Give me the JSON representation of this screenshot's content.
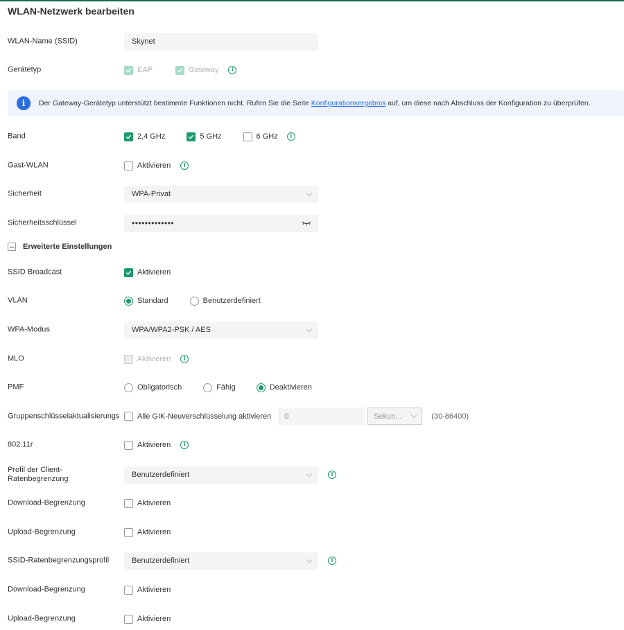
{
  "title": "WLAN-Netzwerk bearbeiten",
  "ssid": {
    "label": "WLAN-Name (SSID)",
    "value": "Skynet"
  },
  "device_type": {
    "label": "Gerätetyp",
    "options": [
      {
        "label": "EAP",
        "checked": true,
        "disabled": true
      },
      {
        "label": "Gateway",
        "checked": true,
        "disabled": true
      }
    ]
  },
  "banner": {
    "text_before": "Der Gateway-Gerätetyp unterstützt bestimmte Funktionen nicht. Rufen Sie die Seite ",
    "link": "Konfigurationsergebnis",
    "text_after": " auf, um diese nach Abschluss der Konfiguration zu überprüfen."
  },
  "band": {
    "label": "Band",
    "options": [
      {
        "label": "2,4 GHz",
        "checked": true
      },
      {
        "label": "5 GHz",
        "checked": true
      },
      {
        "label": "6 GHz",
        "checked": false
      }
    ]
  },
  "guest": {
    "label": "Gast-WLAN",
    "option": "Aktivieren",
    "checked": false
  },
  "security": {
    "label": "Sicherheit",
    "value": "WPA-Privat"
  },
  "key": {
    "label": "Sicherheitsschlüssel",
    "value": "•••••••••••••"
  },
  "advanced": {
    "label": "Erweiterte Einstellungen"
  },
  "ssid_broadcast": {
    "label": "SSID Broadcast",
    "option": "Aktivieren",
    "checked": true
  },
  "vlan": {
    "label": "VLAN",
    "options": [
      {
        "label": "Standard",
        "selected": true
      },
      {
        "label": "Benutzerdefiniert",
        "selected": false
      }
    ]
  },
  "wpa_mode": {
    "label": "WPA-Modus",
    "value": "WPA/WPA2-PSK / AES"
  },
  "mlo": {
    "label": "MLO",
    "option": "Aktivieren",
    "checked": false,
    "disabled": true
  },
  "pmf": {
    "label": "PMF",
    "options": [
      {
        "label": "Obligatorisch",
        "selected": false
      },
      {
        "label": "Fähig",
        "selected": false
      },
      {
        "label": "Deaktivieren",
        "selected": true
      }
    ]
  },
  "gik": {
    "label": "Gruppenschlüsselaktualisierungs",
    "option": "Alle GIK-Neuverschlüsselung aktivieren",
    "checked": false,
    "value": "0",
    "unit": "Sekun...",
    "range": "(30-86400)"
  },
  "r80211": {
    "label": "802.11r",
    "option": "Aktivieren",
    "checked": false
  },
  "client_profile": {
    "label": "Profil der Client-Ratenbegrenzung",
    "value": "Benutzerdefiniert"
  },
  "client_download": {
    "label": "Download-Begrenzung",
    "option": "Aktivieren",
    "checked": false
  },
  "client_upload": {
    "label": "Upload-Begrenzung",
    "option": "Aktivieren",
    "checked": false
  },
  "ssid_profile": {
    "label": "SSID-Ratenbegrenzungsprofil",
    "value": "Benutzerdefiniert"
  },
  "ssid_download": {
    "label": "Download-Begrenzung",
    "option": "Aktivieren",
    "checked": false
  },
  "ssid_upload": {
    "label": "Upload-Begrenzung",
    "option": "Aktivieren",
    "checked": false
  },
  "colors": {
    "accent": "#1a9a6c",
    "link": "#2a6ee0",
    "banner_bg": "#eef3fc",
    "header_border": "#0f6b4f"
  }
}
